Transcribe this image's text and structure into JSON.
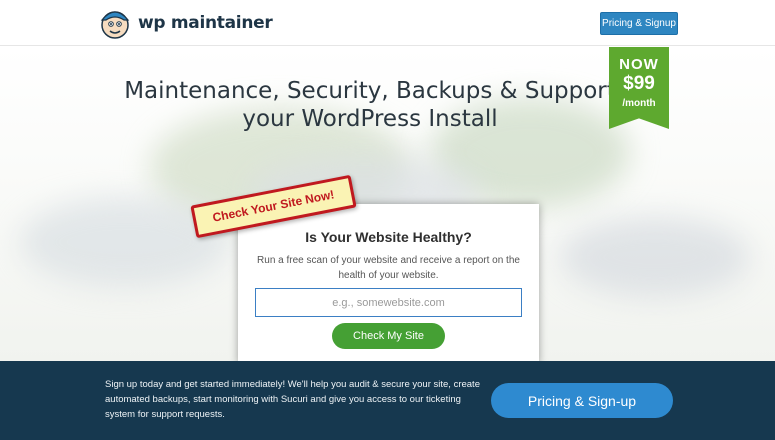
{
  "header": {
    "logo_text": "wp maintainer",
    "signup_button": "Pricing & Signup"
  },
  "hero": {
    "headline": "Maintenance, Security, Backups & Support your WordPress Install",
    "ribbon": {
      "now": "NOW",
      "price": "$99",
      "period": "/month"
    }
  },
  "check": {
    "stamp": "Check Your Site Now!",
    "title": "Is Your Website Healthy?",
    "description": "Run a free scan of your website and receive a report on the health of your website.",
    "input_placeholder": "e.g., somewebsite.com",
    "input_value": "",
    "button": "Check My Site"
  },
  "footer": {
    "text": "Sign up today and get started immediately! We'll help you audit & secure your site, create automated backups, start monitoring with Sucuri and give you access to our ticketing system for support requests.",
    "button": "Pricing & Sign-up"
  },
  "colors": {
    "brand_navy": "#16384f",
    "accent_blue": "#2e86c1",
    "ribbon_green": "#5ea92f",
    "check_green": "#45a034",
    "stamp_red": "#c0191f"
  },
  "icons": {
    "logo": "mascot-icon"
  }
}
